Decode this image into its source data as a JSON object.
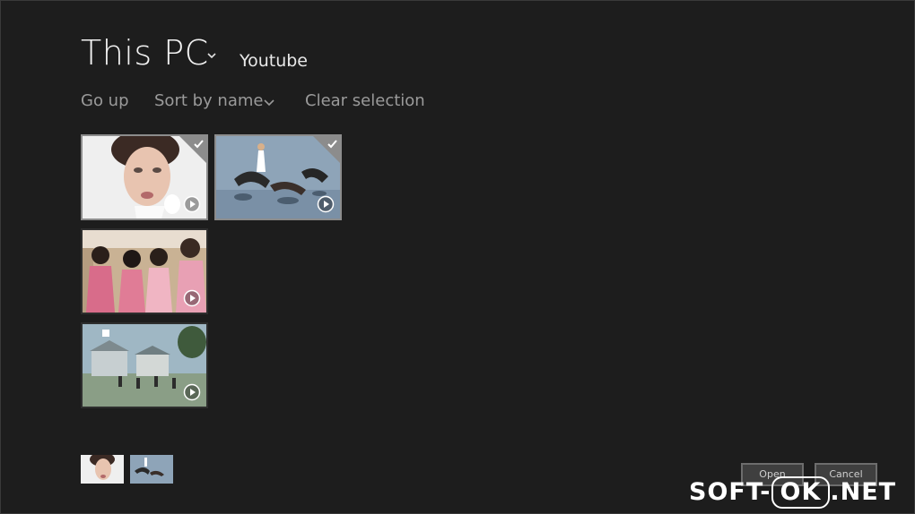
{
  "header": {
    "title": "This PC",
    "folder": "Youtube"
  },
  "commands": {
    "go_up": "Go up",
    "sort": "Sort by name",
    "clear": "Clear selection"
  },
  "tiles": [
    {
      "type": "video",
      "selected": true
    },
    {
      "type": "video",
      "selected": true
    },
    {
      "type": "video",
      "selected": false
    },
    {
      "type": "video",
      "selected": false
    }
  ],
  "footer": {
    "open_label": "Open",
    "cancel_label": "Cancel"
  },
  "watermark": {
    "left": "SOFT-",
    "ok": "OK",
    "right": ".NET"
  },
  "colors": {
    "background": "#1d1d1d",
    "selection_border": "#8c8c8c",
    "command_text": "#9a9a9a"
  }
}
